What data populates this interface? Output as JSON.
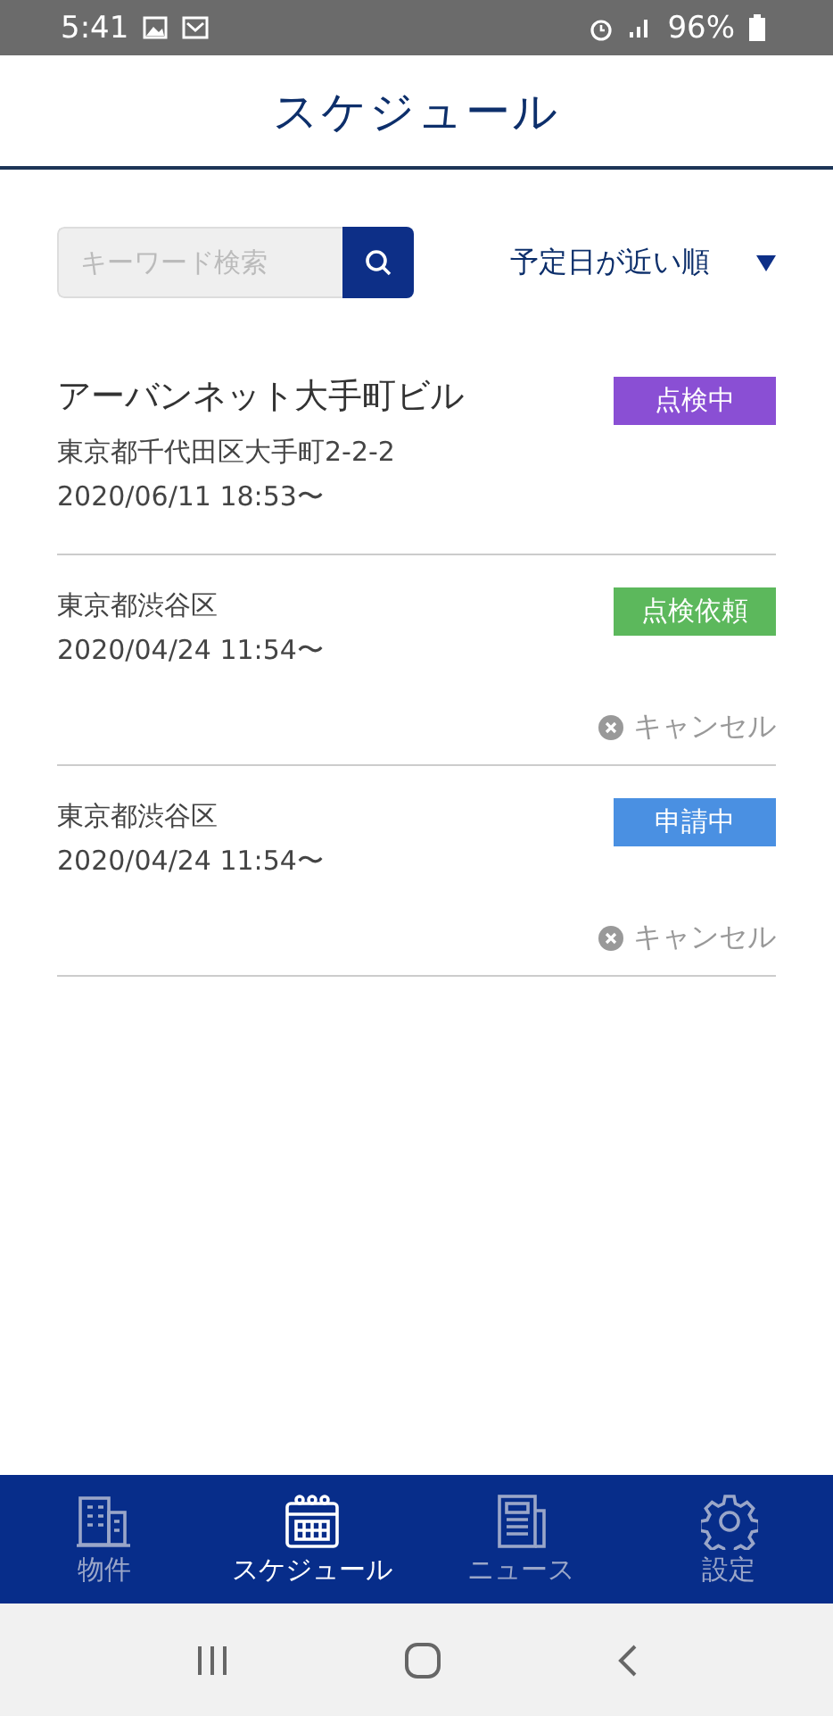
{
  "status_bar": {
    "time": "5:41",
    "battery": "96%"
  },
  "header": {
    "title": "スケジュール"
  },
  "search": {
    "placeholder": "キーワード検索"
  },
  "sort": {
    "label": "予定日が近い順"
  },
  "schedules": [
    {
      "title": "アーバンネット大手町ビル",
      "address": "東京都千代田区大手町2-2-2",
      "date": "2020/06/11 18:53〜",
      "status": "点検中",
      "color": "#8a4fd4"
    },
    {
      "address": "東京都渋谷区",
      "date": "2020/04/24 11:54〜",
      "status": "点検依頼",
      "color": "#5cb85c",
      "cancel": "キャンセル"
    },
    {
      "address": "東京都渋谷区",
      "date": "2020/04/24 11:54〜",
      "status": "申請中",
      "color": "#4a90e2",
      "cancel": "キャンセル"
    }
  ],
  "tabs": [
    {
      "kind": "building",
      "label": "物件",
      "selected": false
    },
    {
      "kind": "calendar",
      "label": "スケジュール",
      "selected": true
    },
    {
      "kind": "news",
      "label": "ニュース",
      "selected": false
    },
    {
      "kind": "gear",
      "label": "設定",
      "selected": false
    }
  ]
}
